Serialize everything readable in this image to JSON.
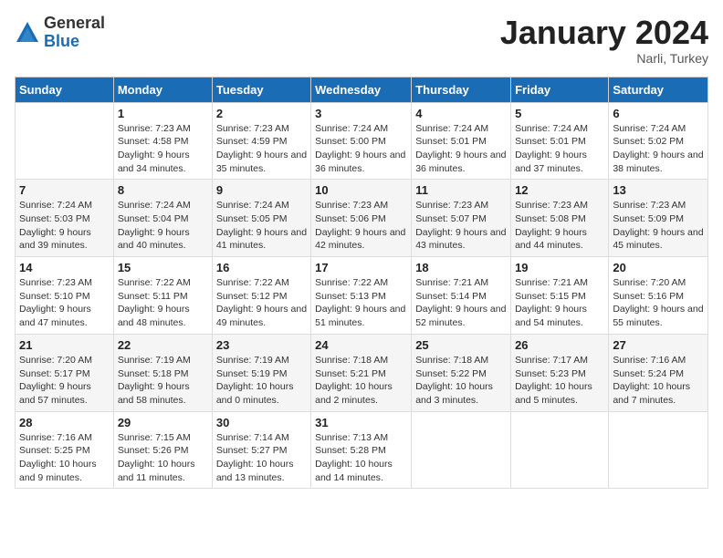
{
  "logo": {
    "general": "General",
    "blue": "Blue"
  },
  "title": "January 2024",
  "location": "Narli, Turkey",
  "days_of_week": [
    "Sunday",
    "Monday",
    "Tuesday",
    "Wednesday",
    "Thursday",
    "Friday",
    "Saturday"
  ],
  "weeks": [
    [
      {
        "day": "",
        "sunrise": "",
        "sunset": "",
        "daylight": ""
      },
      {
        "day": "1",
        "sunrise": "Sunrise: 7:23 AM",
        "sunset": "Sunset: 4:58 PM",
        "daylight": "Daylight: 9 hours and 34 minutes."
      },
      {
        "day": "2",
        "sunrise": "Sunrise: 7:23 AM",
        "sunset": "Sunset: 4:59 PM",
        "daylight": "Daylight: 9 hours and 35 minutes."
      },
      {
        "day": "3",
        "sunrise": "Sunrise: 7:24 AM",
        "sunset": "Sunset: 5:00 PM",
        "daylight": "Daylight: 9 hours and 36 minutes."
      },
      {
        "day": "4",
        "sunrise": "Sunrise: 7:24 AM",
        "sunset": "Sunset: 5:01 PM",
        "daylight": "Daylight: 9 hours and 36 minutes."
      },
      {
        "day": "5",
        "sunrise": "Sunrise: 7:24 AM",
        "sunset": "Sunset: 5:01 PM",
        "daylight": "Daylight: 9 hours and 37 minutes."
      },
      {
        "day": "6",
        "sunrise": "Sunrise: 7:24 AM",
        "sunset": "Sunset: 5:02 PM",
        "daylight": "Daylight: 9 hours and 38 minutes."
      }
    ],
    [
      {
        "day": "7",
        "sunrise": "Sunrise: 7:24 AM",
        "sunset": "Sunset: 5:03 PM",
        "daylight": "Daylight: 9 hours and 39 minutes."
      },
      {
        "day": "8",
        "sunrise": "Sunrise: 7:24 AM",
        "sunset": "Sunset: 5:04 PM",
        "daylight": "Daylight: 9 hours and 40 minutes."
      },
      {
        "day": "9",
        "sunrise": "Sunrise: 7:24 AM",
        "sunset": "Sunset: 5:05 PM",
        "daylight": "Daylight: 9 hours and 41 minutes."
      },
      {
        "day": "10",
        "sunrise": "Sunrise: 7:23 AM",
        "sunset": "Sunset: 5:06 PM",
        "daylight": "Daylight: 9 hours and 42 minutes."
      },
      {
        "day": "11",
        "sunrise": "Sunrise: 7:23 AM",
        "sunset": "Sunset: 5:07 PM",
        "daylight": "Daylight: 9 hours and 43 minutes."
      },
      {
        "day": "12",
        "sunrise": "Sunrise: 7:23 AM",
        "sunset": "Sunset: 5:08 PM",
        "daylight": "Daylight: 9 hours and 44 minutes."
      },
      {
        "day": "13",
        "sunrise": "Sunrise: 7:23 AM",
        "sunset": "Sunset: 5:09 PM",
        "daylight": "Daylight: 9 hours and 45 minutes."
      }
    ],
    [
      {
        "day": "14",
        "sunrise": "Sunrise: 7:23 AM",
        "sunset": "Sunset: 5:10 PM",
        "daylight": "Daylight: 9 hours and 47 minutes."
      },
      {
        "day": "15",
        "sunrise": "Sunrise: 7:22 AM",
        "sunset": "Sunset: 5:11 PM",
        "daylight": "Daylight: 9 hours and 48 minutes."
      },
      {
        "day": "16",
        "sunrise": "Sunrise: 7:22 AM",
        "sunset": "Sunset: 5:12 PM",
        "daylight": "Daylight: 9 hours and 49 minutes."
      },
      {
        "day": "17",
        "sunrise": "Sunrise: 7:22 AM",
        "sunset": "Sunset: 5:13 PM",
        "daylight": "Daylight: 9 hours and 51 minutes."
      },
      {
        "day": "18",
        "sunrise": "Sunrise: 7:21 AM",
        "sunset": "Sunset: 5:14 PM",
        "daylight": "Daylight: 9 hours and 52 minutes."
      },
      {
        "day": "19",
        "sunrise": "Sunrise: 7:21 AM",
        "sunset": "Sunset: 5:15 PM",
        "daylight": "Daylight: 9 hours and 54 minutes."
      },
      {
        "day": "20",
        "sunrise": "Sunrise: 7:20 AM",
        "sunset": "Sunset: 5:16 PM",
        "daylight": "Daylight: 9 hours and 55 minutes."
      }
    ],
    [
      {
        "day": "21",
        "sunrise": "Sunrise: 7:20 AM",
        "sunset": "Sunset: 5:17 PM",
        "daylight": "Daylight: 9 hours and 57 minutes."
      },
      {
        "day": "22",
        "sunrise": "Sunrise: 7:19 AM",
        "sunset": "Sunset: 5:18 PM",
        "daylight": "Daylight: 9 hours and 58 minutes."
      },
      {
        "day": "23",
        "sunrise": "Sunrise: 7:19 AM",
        "sunset": "Sunset: 5:19 PM",
        "daylight": "Daylight: 10 hours and 0 minutes."
      },
      {
        "day": "24",
        "sunrise": "Sunrise: 7:18 AM",
        "sunset": "Sunset: 5:21 PM",
        "daylight": "Daylight: 10 hours and 2 minutes."
      },
      {
        "day": "25",
        "sunrise": "Sunrise: 7:18 AM",
        "sunset": "Sunset: 5:22 PM",
        "daylight": "Daylight: 10 hours and 3 minutes."
      },
      {
        "day": "26",
        "sunrise": "Sunrise: 7:17 AM",
        "sunset": "Sunset: 5:23 PM",
        "daylight": "Daylight: 10 hours and 5 minutes."
      },
      {
        "day": "27",
        "sunrise": "Sunrise: 7:16 AM",
        "sunset": "Sunset: 5:24 PM",
        "daylight": "Daylight: 10 hours and 7 minutes."
      }
    ],
    [
      {
        "day": "28",
        "sunrise": "Sunrise: 7:16 AM",
        "sunset": "Sunset: 5:25 PM",
        "daylight": "Daylight: 10 hours and 9 minutes."
      },
      {
        "day": "29",
        "sunrise": "Sunrise: 7:15 AM",
        "sunset": "Sunset: 5:26 PM",
        "daylight": "Daylight: 10 hours and 11 minutes."
      },
      {
        "day": "30",
        "sunrise": "Sunrise: 7:14 AM",
        "sunset": "Sunset: 5:27 PM",
        "daylight": "Daylight: 10 hours and 13 minutes."
      },
      {
        "day": "31",
        "sunrise": "Sunrise: 7:13 AM",
        "sunset": "Sunset: 5:28 PM",
        "daylight": "Daylight: 10 hours and 14 minutes."
      },
      {
        "day": "",
        "sunrise": "",
        "sunset": "",
        "daylight": ""
      },
      {
        "day": "",
        "sunrise": "",
        "sunset": "",
        "daylight": ""
      },
      {
        "day": "",
        "sunrise": "",
        "sunset": "",
        "daylight": ""
      }
    ]
  ]
}
